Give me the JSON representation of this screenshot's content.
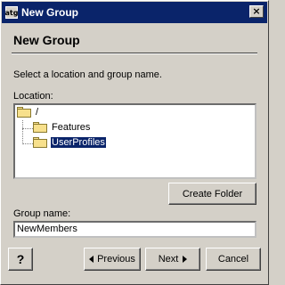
{
  "window": {
    "app_icon_text": "atg",
    "title": "New Group",
    "close_glyph": "×"
  },
  "page": {
    "heading": "New Group",
    "instructions": "Select a location and group name."
  },
  "location": {
    "label": "Location:",
    "tree": [
      {
        "label": "/",
        "icon": "folder-icon",
        "selected": false
      },
      {
        "label": "Features",
        "icon": "folder-icon",
        "selected": false
      },
      {
        "label": "UserProfiles",
        "icon": "folder-open-icon",
        "selected": true
      }
    ]
  },
  "buttons": {
    "create_folder": "Create Folder",
    "help": "?",
    "previous": "Previous",
    "next": "Next",
    "cancel": "Cancel"
  },
  "group_name": {
    "label": "Group name:",
    "value": "NewMembers"
  },
  "colors": {
    "titlebar": "#0a246a",
    "selection": "#0a246a",
    "dialog_bg": "#d4d0c8"
  }
}
